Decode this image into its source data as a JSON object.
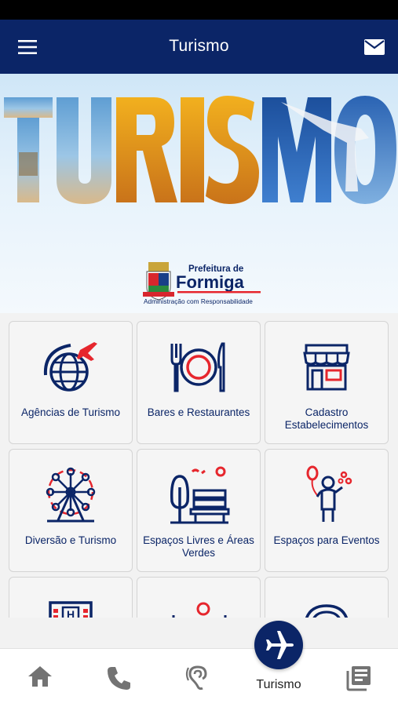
{
  "app_bar": {
    "title": "Turismo",
    "menu_icon": "menu-icon",
    "mail_icon": "mail-icon"
  },
  "banner": {
    "headline": "TURISMO",
    "org_prefix": "Prefeitura de",
    "org_name": "Formiga",
    "org_tagline": "Administração com Responsabilidade"
  },
  "categories": [
    {
      "label": "Agências de Turismo",
      "icon": "globe-plane-icon"
    },
    {
      "label": "Bares e Restaurantes",
      "icon": "plate-cutlery-icon"
    },
    {
      "label": "Cadastro Estabelecimentos",
      "icon": "storefront-icon"
    },
    {
      "label": "Diversão e Turismo",
      "icon": "ferris-wheel-icon"
    },
    {
      "label": "Espaços Livres e Áreas Verdes",
      "icon": "park-bench-icon"
    },
    {
      "label": "Espaços para Eventos",
      "icon": "balloon-person-icon"
    },
    {
      "label": "",
      "icon": "hotel-icon"
    },
    {
      "label": "",
      "icon": "location-fence-icon"
    },
    {
      "label": "",
      "icon": "car-service-icon"
    }
  ],
  "bottom_nav": {
    "items": [
      {
        "icon": "home-icon"
      },
      {
        "icon": "phone-icon"
      },
      {
        "icon": "hearing-icon"
      },
      {
        "icon": "airplane-icon",
        "label": "Turismo",
        "active": true
      },
      {
        "icon": "news-icon"
      }
    ]
  },
  "colors": {
    "primary": "#0b2567",
    "accent_red": "#e6262d",
    "tile_bg": "#f5f5f5",
    "tile_border": "#d4d4d4"
  }
}
